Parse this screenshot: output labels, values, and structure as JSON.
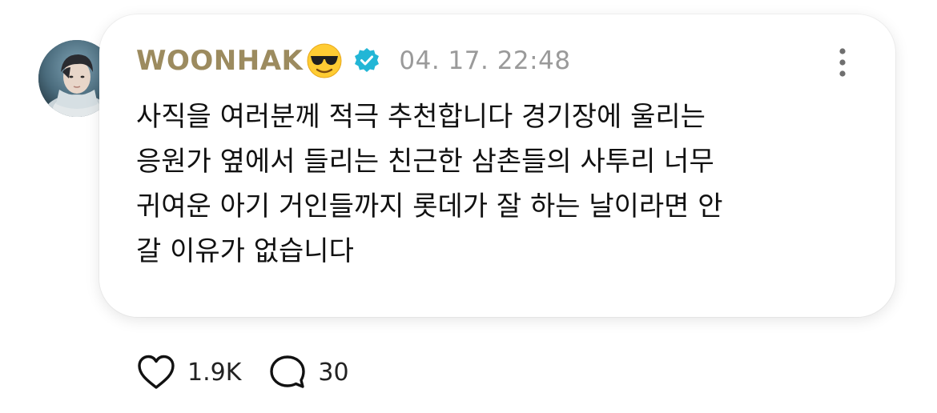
{
  "post": {
    "author": "WOONHAK",
    "emoji_icon": "smiling-face-with-sunglasses-icon",
    "verified_icon": "verified-badge-icon",
    "verified_color": "#22b6d6",
    "author_color": "#9c8b5f",
    "timestamp": "04. 17. 22:48",
    "body_lines": [
      "사직을 여러분께 적극 추천합니다 경기장에 울리는",
      "응원가 옆에서 들리는 친근한 삼촌들의 사투리 너무",
      "귀여운 아기 거인들까지 롯데가 잘 하는 날이라면 안",
      "갈 이유가 없습니다"
    ]
  },
  "actions": {
    "like_icon": "heart-outline-icon",
    "like_count": "1.9K",
    "comment_icon": "comment-bubble-icon",
    "comment_count": "30"
  },
  "menu": {
    "more_icon": "more-vertical-icon"
  }
}
